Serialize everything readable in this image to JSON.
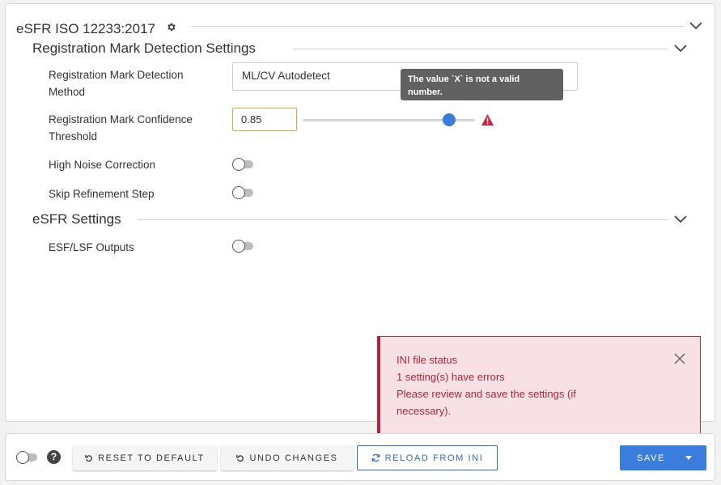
{
  "header": {
    "title": "eSFR ISO 12233:2017"
  },
  "sections": {
    "registration": {
      "title": "Registration Mark Detection Settings"
    },
    "esfr": {
      "title": "eSFR Settings"
    }
  },
  "fields": {
    "method": {
      "label_line1": "Registration Mark Detection",
      "label_line2": "Method",
      "value": "ML/CV Autodetect"
    },
    "threshold": {
      "label_line1": "Registration Mark Confidence",
      "label_line2": "Threshold",
      "value": "0.85",
      "slider_fraction": 0.85
    },
    "high_noise": {
      "label": "High Noise Correction",
      "on": false
    },
    "skip_refinement": {
      "label": "Skip Refinement Step",
      "on": false
    },
    "esf_lsf": {
      "label": "ESF/LSF Outputs",
      "on": false
    }
  },
  "tooltip": {
    "text": "The value `X` is not a valid number."
  },
  "error_box": {
    "title": "INI file status",
    "line1": "1 setting(s) have errors",
    "line2": "Please review and save the settings (if necessary)."
  },
  "footer": {
    "help_symbol": "?",
    "reset_label": "RESET TO DEFAULT",
    "undo_label": "UNDO CHANGES",
    "reload_label": "RELOAD FROM INI",
    "save_label": "SAVE"
  },
  "colors": {
    "accent": "#3b7ddd",
    "error": "#b0263a",
    "warning": "#d0213a",
    "input_error_border": "#f39c3c"
  },
  "icons": {
    "gear": "gear-icon",
    "chevron": "chevron-down-icon",
    "warning": "warning-icon",
    "close": "close-icon",
    "reset": "undo-arrow-icon",
    "reload": "refresh-icon",
    "save_menu": "caret-down-icon"
  }
}
